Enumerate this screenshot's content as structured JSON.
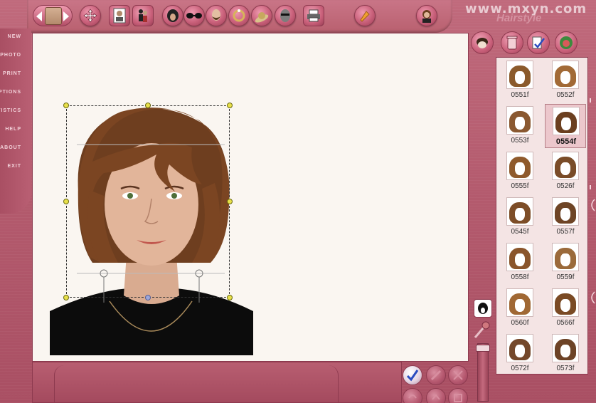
{
  "app": {
    "watermark": "www.mxyn.com",
    "brand_script": "Hairstyle"
  },
  "left_menu": {
    "items": [
      {
        "label": "NEW"
      },
      {
        "label": "PHOTO"
      },
      {
        "label": "PRINT"
      },
      {
        "label": "OPTIONS"
      },
      {
        "label": "STATISTICS"
      },
      {
        "label": "HELP"
      },
      {
        "label": "ABOUT"
      },
      {
        "label": "EXIT"
      }
    ]
  },
  "toolbar": {
    "icons": [
      "previous-photo-icon",
      "next-photo-icon",
      "move-icon",
      "id-photo-icon",
      "people-icon",
      "hair-icon",
      "glasses-icon",
      "beard-icon",
      "jewelry-icon",
      "hat-icon",
      "mask-icon",
      "print-icon",
      "color-brush-icon",
      "portrait-icon"
    ]
  },
  "gallery": {
    "selected": "0554f",
    "items": [
      {
        "code": "0551f",
        "color": "#8b5a2b"
      },
      {
        "code": "0552f",
        "color": "#a26a36"
      },
      {
        "code": "0553f",
        "color": "#8a5830"
      },
      {
        "code": "0554f",
        "color": "#6b3f1f"
      },
      {
        "code": "0555f",
        "color": "#8f5a2c"
      },
      {
        "code": "0526f",
        "color": "#7a4c28"
      },
      {
        "code": "0545f",
        "color": "#7d4d27"
      },
      {
        "code": "0557f",
        "color": "#6e4425"
      },
      {
        "code": "0558f",
        "color": "#8a552b"
      },
      {
        "code": "0559f",
        "color": "#9b6a3a"
      },
      {
        "code": "0560f",
        "color": "#a06834"
      },
      {
        "code": "0566f",
        "color": "#7a4a24"
      },
      {
        "code": "0572f",
        "color": "#74482a"
      },
      {
        "code": "0573f",
        "color": "#6d4326"
      }
    ]
  },
  "colors": {
    "frame": "#b2576a",
    "canvas": "#faf6f1",
    "gallery_bg": "#f4e4e4",
    "selected_bg": "#ecc7cc",
    "handle": "#e8e04a"
  }
}
